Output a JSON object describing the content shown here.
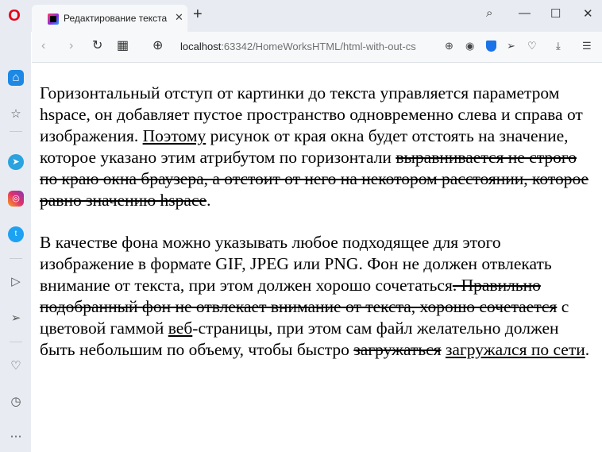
{
  "browser": {
    "tab_title": "Редактирование текста",
    "tab_close": "✕",
    "new_tab": "+",
    "url_host": "localhost",
    "url_rest": ":63342/HomeWorksHTML/html-with-out-cs"
  },
  "icons": {
    "opera": "O",
    "back": "‹",
    "forward": "›",
    "reload": "↻",
    "speed_dial": "▦",
    "globe": "⊕",
    "search": "⌕",
    "minimize": "—",
    "maximize": "☐",
    "close": "✕",
    "camera": "◉",
    "send": "➢",
    "heart": "♡",
    "download": "⤓",
    "menu": "☰",
    "zoom": "⊕",
    "sb_bookmarks": "☆",
    "sb_telegram": "➤",
    "sb_instagram": "◎",
    "sb_twitter": "t",
    "sb_player": "▷",
    "sb_send": "➢",
    "sb_heart": "♡",
    "sb_history": "◷",
    "sb_more": "⋯"
  },
  "content": {
    "p1": {
      "t1": "Горизонтальный отступ от картинки до текста управляется параметром hspace, он добавляет пустое пространство одновременно слева и справа от изображения. ",
      "u1": "Поэтому",
      "t2": " рисунок от края окна будет отстоять на значение, которое указано этим атрибутом по горизонтали ",
      "s1": "выравнивается не строго по краю окна браузера, а отстоит от него на некотором расстоянии, которое равно значению hspace",
      "t3": "."
    },
    "p2": {
      "t1": "В качестве фона можно указывать любое подходящее для этого изображение в формате GIF, JPEG или PNG. Фон не должен отвлекать внимание от текста, при этом должен хорошо сочетаться",
      "s1": ". Правильно подобранный фон не отвлекает внимание от текста, хорошо сочетается",
      "t2": " с цветовой гаммой ",
      "u1": "веб",
      "t3": "-страницы, при этом сам файл желательно должен быть небольшим по объему, чтобы быстро ",
      "s2": "загружаться",
      "t4": " ",
      "u2": "загружался по сети",
      "t5": "."
    }
  }
}
